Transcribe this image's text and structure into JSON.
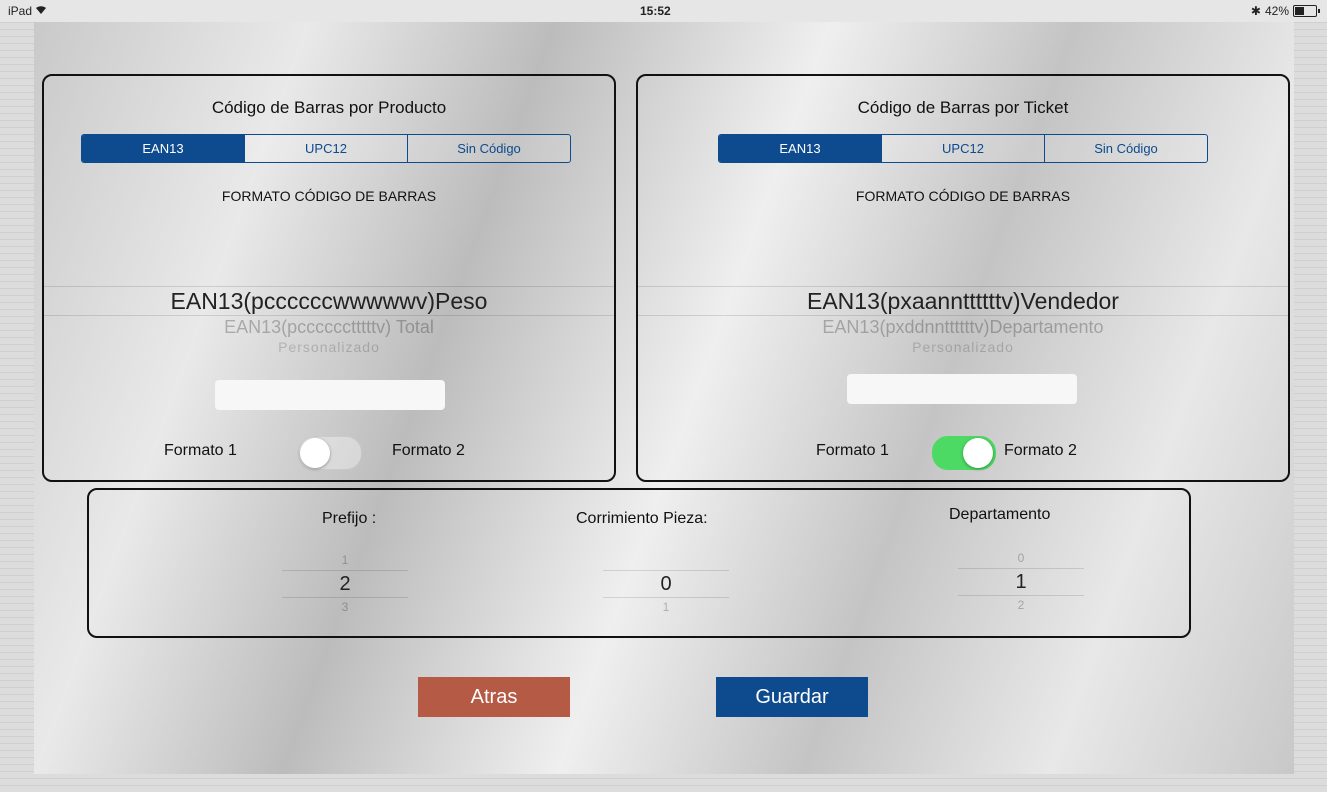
{
  "status_bar": {
    "device": "iPad",
    "wifi_icon": "wifi-icon",
    "time": "15:52",
    "battery_percent": "42%",
    "battery_level": 0.42
  },
  "colors": {
    "accent_blue": "#0d4a8e",
    "back_button": "#b55a45",
    "switch_on": "#4cd964"
  },
  "producto": {
    "title": "Código de Barras por Producto",
    "segments": [
      "EAN13",
      "UPC12",
      "Sin Código"
    ],
    "selected_segment": "EAN13",
    "format_label": "FORMATO CÓDIGO DE BARRAS",
    "picker": {
      "selected": "EAN13(pccccccwwwwwv)Peso",
      "below_1": "EAN13(pcccccctttttv) Total",
      "below_2": "Personalizado"
    },
    "custom_value": "",
    "toggle": {
      "label_left": "Formato 1",
      "label_right": "Formato 2",
      "on": false
    }
  },
  "ticket": {
    "title": "Código de Barras por Ticket",
    "segments": [
      "EAN13",
      "UPC12",
      "Sin Código"
    ],
    "selected_segment": "EAN13",
    "format_label": "FORMATO CÓDIGO DE BARRAS",
    "picker": {
      "selected": "EAN13(pxaannttttttv)Vendedor",
      "below_1": "EAN13(pxddnnttttttv)Departamento",
      "below_2": "Personalizado"
    },
    "custom_value": "",
    "toggle": {
      "label_left": "Formato 1",
      "label_right": "Formato 2",
      "on": true
    }
  },
  "settings": {
    "prefijo": {
      "label": "Prefijo :",
      "above": "1",
      "selected": "2",
      "below": "3"
    },
    "corrimiento": {
      "label": "Corrimiento Pieza:",
      "above": "",
      "selected": "0",
      "below": "1"
    },
    "departamento": {
      "label": "Departamento",
      "above": "0",
      "selected": "1",
      "below": "2"
    }
  },
  "buttons": {
    "back": "Atras",
    "save": "Guardar"
  }
}
